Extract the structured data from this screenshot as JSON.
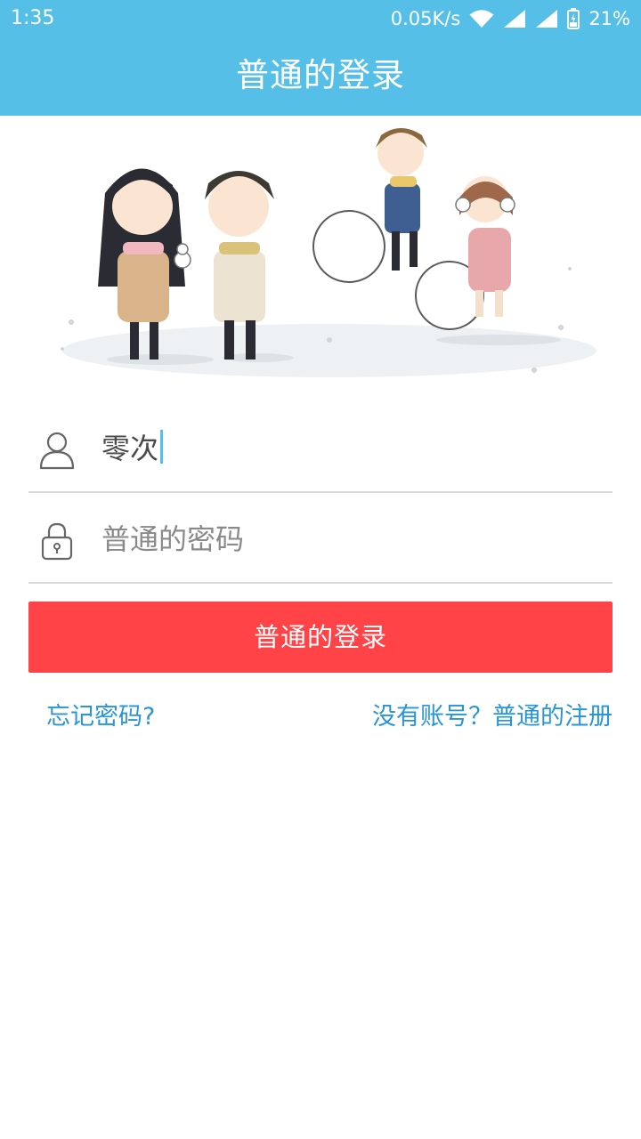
{
  "status_bar": {
    "time": "1:35",
    "network_speed": "0.05K/s",
    "battery": "21%",
    "icons": [
      "wifi-icon",
      "signal-icon",
      "signal-icon",
      "battery-icon"
    ]
  },
  "app_bar": {
    "title": "普通的登录"
  },
  "banner": {
    "description_icon": "illustration-image"
  },
  "form": {
    "username": {
      "icon": "user-icon",
      "value": "零次"
    },
    "password": {
      "icon": "lock-icon",
      "placeholder": "普通的密码"
    },
    "login_button": "普通的登录",
    "forgot_password": "忘记密码?",
    "register": "没有账号？普通的注册"
  },
  "colors": {
    "primary": "#55bfe8",
    "login_button": "#ff4346",
    "link": "#2796d6",
    "divider": "#d9d9d9"
  }
}
